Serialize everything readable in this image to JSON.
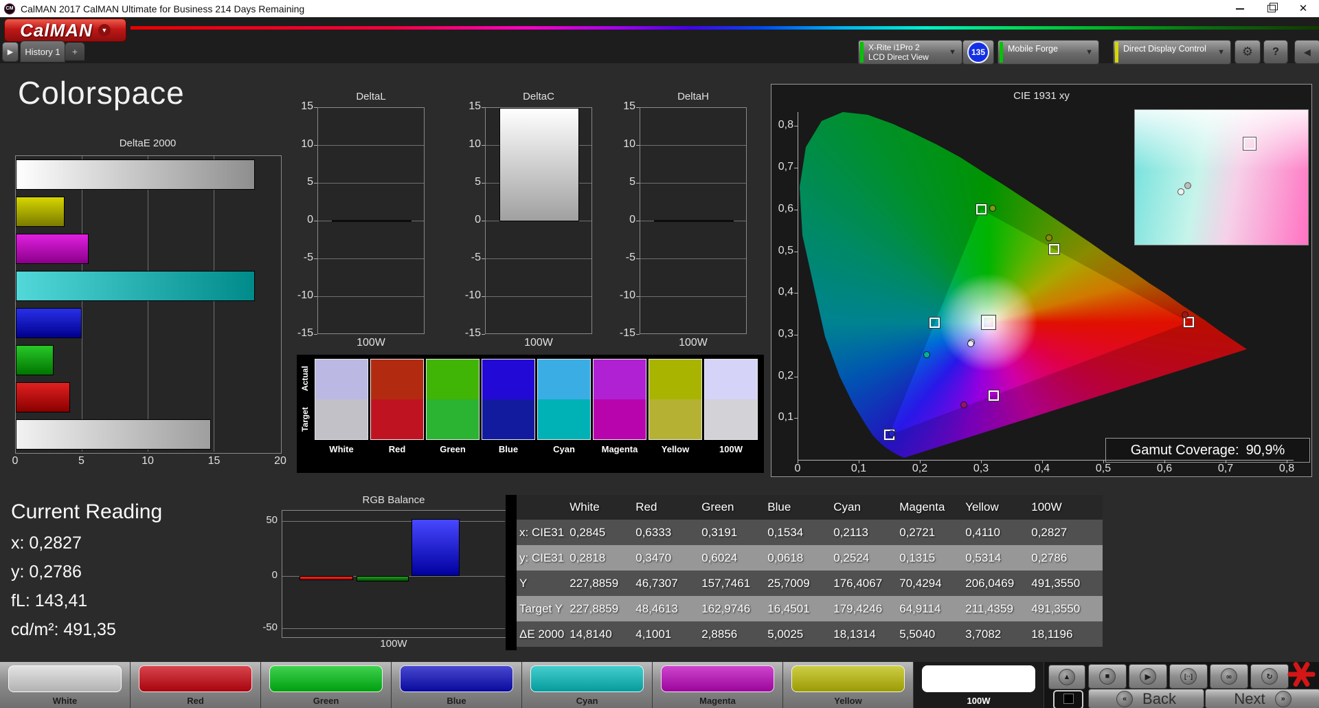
{
  "window": {
    "title": "CalMAN 2017 CalMAN Ultimate for Business 214 Days Remaining",
    "app_icon": "CM"
  },
  "logo": {
    "brand": "CalMAN"
  },
  "tabs": {
    "history_tab": "History 1",
    "add_tab": "+"
  },
  "toolbar": {
    "meter": {
      "line1": "X-Rite i1Pro 2",
      "line2": "LCD Direct View",
      "badge": "135",
      "accent": "#00c400"
    },
    "source": {
      "label": "Mobile Forge",
      "accent": "#00c400"
    },
    "display": {
      "label": "Direct Display Control",
      "accent": "#d8d800"
    }
  },
  "page": {
    "title": "Colorspace"
  },
  "chart_data": [
    {
      "id": "deltae2000",
      "type": "bar",
      "orientation": "horizontal",
      "title": "DeltaE 2000",
      "categories": [
        "100W",
        "Yellow",
        "Magenta",
        "Cyan",
        "Blue",
        "Green",
        "Red",
        "White"
      ],
      "values": [
        18.1196,
        3.7082,
        5.504,
        18.1314,
        5.0025,
        2.8856,
        4.1001,
        14.814
      ],
      "colors": [
        [
          "#ffffff",
          "#8e8e8e"
        ],
        [
          "#d6d600",
          "#7a7a00"
        ],
        [
          "#e020e0",
          "#8a008a"
        ],
        [
          "#52d8d8",
          "#008a8a"
        ],
        [
          "#2830e8",
          "#00008c"
        ],
        [
          "#28c828",
          "#007400"
        ],
        [
          "#e02020",
          "#8a0000"
        ],
        [
          "#f2f2f2",
          "#9e9e9e"
        ]
      ],
      "xlim": [
        0,
        20
      ],
      "x_ticks": [
        "0",
        "5",
        "10",
        "15",
        "20"
      ],
      "grid": true
    },
    {
      "id": "deltaL",
      "type": "bar",
      "title": "DeltaL",
      "categories": [
        "100W"
      ],
      "values": [
        0
      ],
      "xlabel": "100W",
      "ylim": [
        -15,
        15
      ],
      "y_ticks": [
        "15",
        "10",
        "5",
        "0",
        "-5",
        "-10",
        "-15"
      ],
      "grid": true
    },
    {
      "id": "deltaC",
      "type": "bar",
      "title": "DeltaC",
      "categories": [
        "100W"
      ],
      "values": [
        15
      ],
      "clipped": true,
      "xlabel": "100W",
      "bar_colors": [
        "#ffffff",
        "#a0a0a0"
      ],
      "ylim": [
        -15,
        15
      ],
      "y_ticks": [
        "15",
        "10",
        "5",
        "0",
        "-5",
        "-10",
        "-15"
      ],
      "grid": true
    },
    {
      "id": "deltaH",
      "type": "bar",
      "title": "DeltaH",
      "categories": [
        "100W"
      ],
      "values": [
        0
      ],
      "xlabel": "100W",
      "ylim": [
        -15,
        15
      ],
      "y_ticks": [
        "15",
        "10",
        "5",
        "0",
        "-5",
        "-10",
        "-15"
      ],
      "grid": true
    },
    {
      "id": "rgb_balance",
      "type": "bar",
      "title": "RGB Balance",
      "categories": [
        "100W"
      ],
      "xlabel": "100W",
      "series": [
        {
          "name": "Red",
          "values": [
            -4
          ],
          "colors": [
            "#ff3020",
            "#a80000"
          ]
        },
        {
          "name": "Green",
          "values": [
            -5
          ],
          "colors": [
            "#20a020",
            "#004e00"
          ]
        },
        {
          "name": "Blue",
          "values": [
            52
          ],
          "colors": [
            "#4848ff",
            "#0000a0"
          ]
        }
      ],
      "ylim": [
        -60,
        60
      ],
      "y_ticks": [
        "50",
        "0",
        "-50"
      ],
      "grid": true
    },
    {
      "id": "cie1931",
      "type": "scatter",
      "title": "CIE 1931 xy",
      "x_ticks": [
        "0",
        "0,1",
        "0,2",
        "0,3",
        "0,4",
        "0,5",
        "0,6",
        "0,7",
        "0,8"
      ],
      "y_ticks": [
        "0,8",
        "0,7",
        "0,6",
        "0,5",
        "0,4",
        "0,3",
        "0,2",
        "0,1"
      ],
      "gamut_triangle": [
        [
          0.64,
          0.33
        ],
        [
          0.3,
          0.6
        ],
        [
          0.15,
          0.06
        ]
      ],
      "points": [
        {
          "name": "White",
          "target": [
            0.3127,
            0.329
          ],
          "measured": [
            0.2845,
            0.2818
          ],
          "dot": "#ffffff",
          "big": true
        },
        {
          "name": "Red",
          "target": [
            0.64,
            0.33
          ],
          "measured": [
            0.6333,
            0.347
          ],
          "dot": "#a81414"
        },
        {
          "name": "Green",
          "target": [
            0.3,
            0.6
          ],
          "measured": [
            0.3191,
            0.6024
          ],
          "dot": "#7a9a10"
        },
        {
          "name": "Blue",
          "target": [
            0.15,
            0.06
          ],
          "measured": [
            0.1534,
            0.0618
          ],
          "dot": "#2222cc"
        },
        {
          "name": "Cyan",
          "target": [
            0.2246,
            0.3287
          ],
          "measured": [
            0.2113,
            0.2524
          ],
          "dot": "#00b09a"
        },
        {
          "name": "Magenta",
          "target": [
            0.3209,
            0.1542
          ],
          "measured": [
            0.2721,
            0.1315
          ],
          "dot": "#991166"
        },
        {
          "name": "Yellow",
          "target": [
            0.4193,
            0.5053
          ],
          "measured": [
            0.411,
            0.5314
          ],
          "dot": "#8a8a00"
        },
        {
          "name": "100W",
          "measured": [
            0.2827,
            0.2786
          ],
          "dot": "#e8e8ff"
        }
      ]
    }
  ],
  "cie": {
    "title": "CIE 1931 xy",
    "gamut_coverage_label": "Gamut Coverage:",
    "gamut_coverage_value": "90,9%"
  },
  "current_reading": {
    "title": "Current Reading",
    "items": [
      {
        "label": "x:",
        "value": "0,2827"
      },
      {
        "label": "y:",
        "value": "0,2786"
      },
      {
        "label": "fL:",
        "value": "143,41"
      },
      {
        "label": "cd/m²:",
        "value": "491,35"
      }
    ]
  },
  "swatch_compare": {
    "row_labels": [
      "Actual",
      "Target"
    ],
    "columns": [
      {
        "label": "White",
        "actual": "#bcb8e4",
        "target": "#c2c1c7"
      },
      {
        "label": "Red",
        "actual": "#b22b10",
        "target": "#c01321"
      },
      {
        "label": "Green",
        "actual": "#41b506",
        "target": "#2ab431"
      },
      {
        "label": "Blue",
        "actual": "#2209d6",
        "target": "#121b9e"
      },
      {
        "label": "Cyan",
        "actual": "#3bade5",
        "target": "#00b2b6"
      },
      {
        "label": "Magenta",
        "actual": "#b021d4",
        "target": "#b704ad"
      },
      {
        "label": "Yellow",
        "actual": "#a9b400",
        "target": "#b5b233"
      },
      {
        "label": "100W",
        "actual": "#d6d3f8",
        "target": "#d3d2d6"
      }
    ]
  },
  "measurements_table": {
    "headers": [
      "",
      "White",
      "Red",
      "Green",
      "Blue",
      "Cyan",
      "Magenta",
      "Yellow",
      "100W"
    ],
    "rows": [
      {
        "label": "x: CIE31",
        "values": [
          "0,2845",
          "0,6333",
          "0,3191",
          "0,1534",
          "0,2113",
          "0,2721",
          "0,4110",
          "0,2827"
        ]
      },
      {
        "label": "y: CIE31",
        "values": [
          "0,2818",
          "0,3470",
          "0,6024",
          "0,0618",
          "0,2524",
          "0,1315",
          "0,5314",
          "0,2786"
        ]
      },
      {
        "label": "Y",
        "values": [
          "227,8859",
          "46,7307",
          "157,7461",
          "25,7009",
          "176,4067",
          "70,4294",
          "206,0469",
          "491,3550"
        ]
      },
      {
        "label": "Target Y",
        "values": [
          "227,8859",
          "48,4613",
          "162,9746",
          "16,4501",
          "179,4246",
          "64,9114",
          "211,4359",
          "491,3550"
        ]
      },
      {
        "label": "ΔE 2000",
        "values": [
          "14,8140",
          "4,1001",
          "2,8856",
          "5,0025",
          "18,1314",
          "5,5040",
          "3,7082",
          "18,1196"
        ]
      }
    ]
  },
  "pattern_bar": {
    "buttons": [
      {
        "label": "White",
        "color": "#d9d9d9",
        "selected": false
      },
      {
        "label": "Red",
        "color": "#cc0511",
        "selected": false
      },
      {
        "label": "Green",
        "color": "#00c214",
        "selected": false
      },
      {
        "label": "Blue",
        "color": "#0b0bbf",
        "selected": false
      },
      {
        "label": "Cyan",
        "color": "#06bdbd",
        "selected": false
      },
      {
        "label": "Magenta",
        "color": "#bd06bd",
        "selected": false
      },
      {
        "label": "Yellow",
        "color": "#bdbd06",
        "selected": false
      },
      {
        "label": "100W",
        "color": "#ffffff",
        "selected": true
      }
    ]
  },
  "transport": {
    "buttons": [
      {
        "name": "stop",
        "glyph": "■"
      },
      {
        "name": "play",
        "glyph": "▶"
      },
      {
        "name": "step",
        "glyph": "[··]"
      },
      {
        "name": "loop",
        "glyph": "∞"
      },
      {
        "name": "refresh",
        "glyph": "↻"
      }
    ]
  },
  "nav": {
    "back": "Back",
    "next": "Next"
  }
}
